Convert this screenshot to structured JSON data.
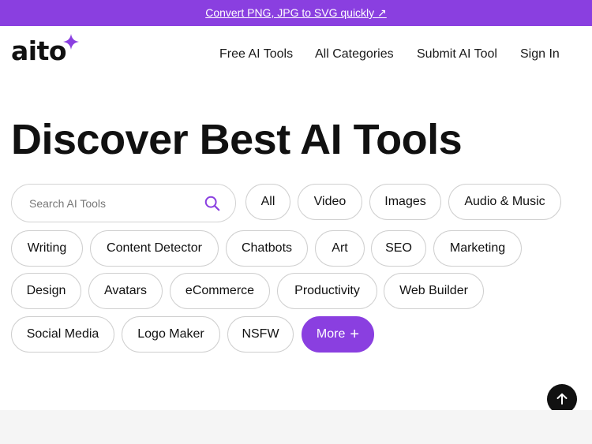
{
  "banner": {
    "text": "Convert PNG, JPG to SVG quickly ↗"
  },
  "header": {
    "logo_text": "aito",
    "nav": [
      {
        "label": "Free AI Tools"
      },
      {
        "label": "All Categories"
      },
      {
        "label": "Submit AI Tool"
      },
      {
        "label": "Sign In"
      }
    ]
  },
  "hero": {
    "title": "Discover Best AI Tools"
  },
  "search": {
    "placeholder": "Search AI Tools"
  },
  "categories": [
    {
      "label": "All"
    },
    {
      "label": "Video"
    },
    {
      "label": "Images"
    },
    {
      "label": "Audio & Music"
    },
    {
      "label": "Writing"
    },
    {
      "label": "Content Detector"
    },
    {
      "label": "Chatbots"
    },
    {
      "label": "Art"
    },
    {
      "label": "SEO"
    },
    {
      "label": "Marketing"
    },
    {
      "label": "Design"
    },
    {
      "label": "Avatars"
    },
    {
      "label": "eCommerce"
    },
    {
      "label": "Productivity"
    },
    {
      "label": "Web Builder"
    },
    {
      "label": "Social Media"
    },
    {
      "label": "Logo Maker"
    },
    {
      "label": "NSFW"
    }
  ],
  "more_button": {
    "label": "More"
  },
  "colors": {
    "accent": "#8a3fe0",
    "text": "#111111",
    "chip_border": "#cfcfcf"
  }
}
